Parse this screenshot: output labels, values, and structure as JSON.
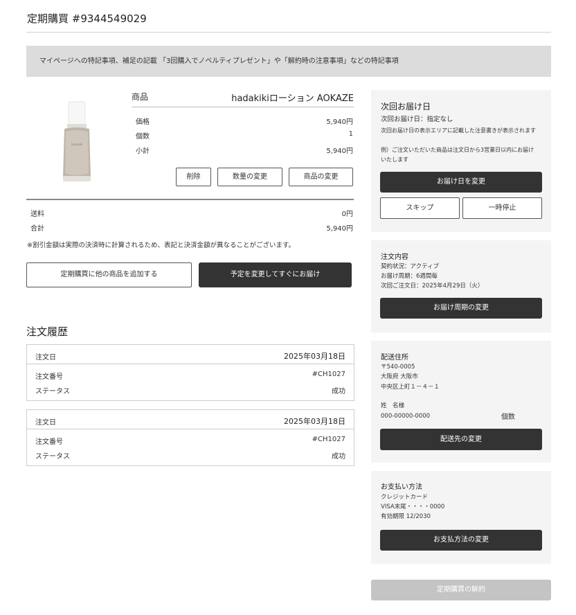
{
  "header": {
    "title": "定期購買 #9344549029"
  },
  "notice": "マイページへの特記事項、補足の記載 「3回購入でノベルティプレゼント」や「解約時の注意事項」などの特記事項",
  "product": {
    "name_label": "商品",
    "name": "hadakikiローション AOKAZE",
    "price_label": "価格",
    "price": "5,940円",
    "qty_label": "個数",
    "qty": "1",
    "subtotal_label": "小計",
    "subtotal": "5,940円",
    "delete_label": "削除",
    "change_qty_label": "数量の変更",
    "change_product_label": "商品の変更"
  },
  "totals": {
    "shipping_label": "送料",
    "shipping": "0円",
    "total_label": "合計",
    "total": "5,940円",
    "note": "※割引金額は実際の決済時に計算されるため、表記と決済金額が異なることがございます。"
  },
  "actions": {
    "add_label": "定期購買に他の商品を追加する",
    "ship_now_label": "予定を変更してすぐにお届け"
  },
  "history": {
    "title": "注文履歴",
    "orders": [
      {
        "date_label": "注文日",
        "date": "2025年03月18日",
        "number_label": "注文番号",
        "number": "#CH1027",
        "status_label": "ステータス",
        "status": "成功"
      },
      {
        "date_label": "注文日",
        "date": "2025年03月18日",
        "number_label": "注文番号",
        "number": "#CH1027",
        "status_label": "ステータス",
        "status": "成功"
      }
    ]
  },
  "next_delivery": {
    "title": "次回お届け日",
    "date_line": "次回お届け日：指定なし",
    "desc": "次回お届け日の表示エリアに記載した注意書きが表示されます",
    "example": "例）ご注文いただいた商品は注文日から3営業日以内にお届け",
    "example2": "いたします",
    "change_date_label": "お届け日を変更",
    "skip_label": "スキップ",
    "pause_label": "一時停止"
  },
  "order_info": {
    "title": "注文内容",
    "status": "契約状況：アクティブ",
    "cycle": "お届け周期：6週間毎",
    "next_order": "次回ご注文日：2025年4月29日（火）",
    "change_cycle_label": "お届け周期の変更"
  },
  "address": {
    "title": "配送住所",
    "zip": "〒540-0005",
    "pref": "大阪府 大阪市",
    "street": "中央区上町１－４－１",
    "name": "姓　名様",
    "phone": "000-00000-0000",
    "qty_label": "個数",
    "change_label": "配送先の変更"
  },
  "payment": {
    "title": "お支払い方法",
    "method": "クレジットカード",
    "card": "VISA末尾・・・・0000",
    "expiry": "有効期限 12/2030",
    "change_label": "お支払方法の変更"
  },
  "cancel_label": "定期購買の解約"
}
